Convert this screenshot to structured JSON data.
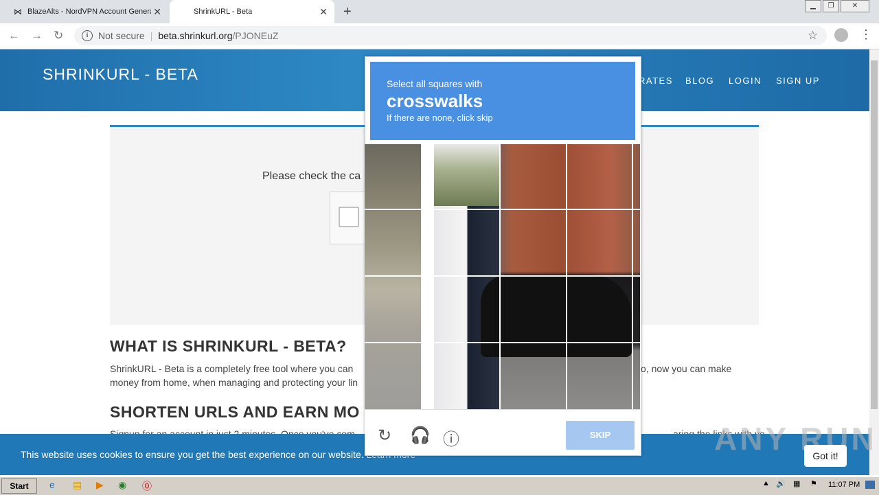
{
  "browser": {
    "tabs": [
      {
        "title": "BlazeAlts - NordVPN Account Genera"
      },
      {
        "title": "ShrinkURL - Beta"
      }
    ],
    "omnibox": {
      "security": "Not secure",
      "host": "beta.shrinkurl.org",
      "path": "/PJONEuZ"
    }
  },
  "site": {
    "brand": "SHRINKURL - BETA",
    "nav": [
      "RATES",
      "BLOG",
      "LOGIN",
      "SIGN UP"
    ],
    "captcha_prompt": "Please check the ca",
    "section1_title": "WHAT IS SHRINKURL - BETA?",
    "section1_line1a": "ShrinkURL - Beta is a completely free tool where you can",
    "section1_line1b": "o, now you can make",
    "section1_line2": "money from home, when managing and protecting your lin",
    "section2_title": "SHORTEN URLS AND EARN MO",
    "section2_peek": "Signup for an account in just 2 minutes. Once you've com",
    "section2_peek2": "aring the links with yo",
    "cookie_text": "This website uses cookies to ensure you get the best experience on our website.",
    "cookie_link": "Learn more",
    "gotit": "Got it!"
  },
  "recaptcha": {
    "line1": "Select all squares with",
    "target": "crosswalks",
    "line3": "If there are none, click skip",
    "skip": "SKIP"
  },
  "watermark": "ANY RUN",
  "taskbar": {
    "start": "Start",
    "clock": "11:07 PM"
  }
}
